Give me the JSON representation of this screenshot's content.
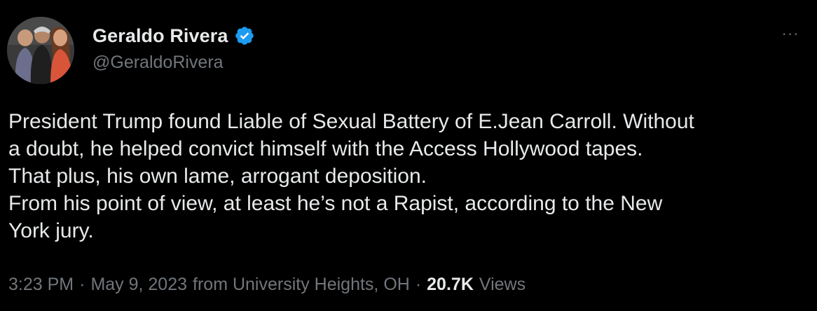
{
  "author": {
    "display_name": "Geraldo Rivera",
    "handle": "@GeraldoRivera",
    "verified": true,
    "verified_color": "#1d9bf0"
  },
  "menu": {
    "more_icon": "more-dots-icon",
    "label": "···"
  },
  "tweet": {
    "lines": [
      "President Trump found Liable of Sexual Battery of E.Jean Carroll. Without",
      "a doubt, he helped convict himself with the Access Hollywood tapes.",
      "That plus, his own lame, arrogant deposition.",
      "From his point of view, at least he’s not a Rapist, according to the New",
      "York jury."
    ]
  },
  "meta": {
    "time": "3:23 PM",
    "separator": "·",
    "date": "May 9, 2023",
    "location": "from University Heights, OH",
    "views_count": "20.7K",
    "views_label": "Views"
  }
}
